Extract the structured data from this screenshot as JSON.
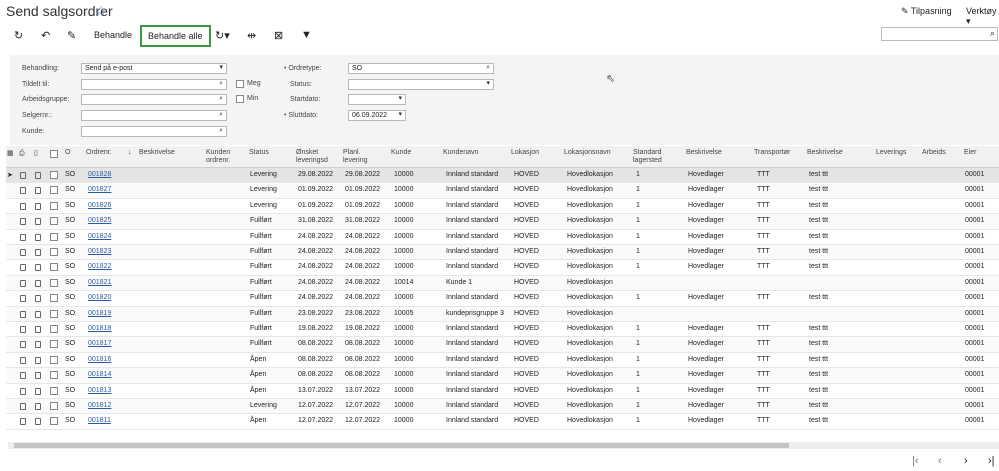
{
  "header": {
    "title": "Send salgsordrer",
    "customize": "Tilpasning",
    "tools": "Verktøy"
  },
  "toolbar": {
    "process": "Behandle",
    "process_all": "Behandle alle",
    "search_placeholder": ""
  },
  "filters": {
    "action_label": "Behandling:",
    "action_value": "Send på e-post",
    "assigned_label": "Tildelt til:",
    "assigned_value": "",
    "workgroup_label": "Arbeidsgruppe:",
    "workgroup_value": "",
    "salesperson_label": "Selgernr.:",
    "salesperson_value": "",
    "customer_label": "Kunde:",
    "customer_value": "",
    "me_label": "Meg",
    "my_label": "Min",
    "ordertype_label": "Ordretype:",
    "ordertype_value": "SO",
    "status_label": "Status:",
    "status_value": "",
    "startdate_label": "Startdato:",
    "startdate_value": "",
    "enddate_label": "Sluttdato:",
    "enddate_value": "06.09.2022"
  },
  "grid": {
    "headers": {
      "o": "O",
      "ordernr": "Ordrenr.",
      "sort": "↓",
      "desc": "Beskrivelse",
      "custorder": "Kunden ordrenr.",
      "status": "Status",
      "desired": "Ønsket leveringsd",
      "planned": "Planl. levering",
      "customer": "Kunde",
      "custname": "Kundenavn",
      "location": "Lokasjon",
      "locname": "Lokasjonsnavn",
      "stdwh": "Standard lagersted",
      "whdesc": "Beskrivelse",
      "carrier": "Transportør",
      "carrierdesc": "Beskrivelse",
      "delivery": "Leverings",
      "work": "Arbeids",
      "owner": "Eier"
    },
    "rows": [
      {
        "o": "SO",
        "nr": "001828",
        "status": "Levering",
        "desired": "29.08.2022",
        "planned": "29.08.2022",
        "cust": "10000",
        "custname": "Innland standard",
        "loc": "HOVED",
        "locname": "Hovedlokasjon",
        "wh": "1",
        "whdesc": "Hovedlager",
        "car": "TTT",
        "cardesc": "test ttt",
        "owner": "00001"
      },
      {
        "o": "SO",
        "nr": "001827",
        "status": "Levering",
        "desired": "01.09.2022",
        "planned": "01.09.2022",
        "cust": "10000",
        "custname": "Innland standard",
        "loc": "HOVED",
        "locname": "Hovedlokasjon",
        "wh": "1",
        "whdesc": "Hovedlager",
        "car": "TTT",
        "cardesc": "test ttt",
        "owner": "00001"
      },
      {
        "o": "SO",
        "nr": "001826",
        "status": "Levering",
        "desired": "01.09.2022",
        "planned": "01.09.2022",
        "cust": "10000",
        "custname": "Innland standard",
        "loc": "HOVED",
        "locname": "Hovedlokasjon",
        "wh": "1",
        "whdesc": "Hovedlager",
        "car": "TTT",
        "cardesc": "test ttt",
        "owner": "00001"
      },
      {
        "o": "SO",
        "nr": "001825",
        "status": "Fullført",
        "desired": "31.08.2022",
        "planned": "31.08.2022",
        "cust": "10000",
        "custname": "Innland standard",
        "loc": "HOVED",
        "locname": "Hovedlokasjon",
        "wh": "1",
        "whdesc": "Hovedlager",
        "car": "TTT",
        "cardesc": "test ttt",
        "owner": "00001"
      },
      {
        "o": "SO",
        "nr": "001824",
        "status": "Fullført",
        "desired": "24.08.2022",
        "planned": "24.08.2022",
        "cust": "10000",
        "custname": "Innland standard",
        "loc": "HOVED",
        "locname": "Hovedlokasjon",
        "wh": "1",
        "whdesc": "Hovedlager",
        "car": "TTT",
        "cardesc": "test ttt",
        "owner": "00001"
      },
      {
        "o": "SO",
        "nr": "001823",
        "status": "Fullført",
        "desired": "24.08.2022",
        "planned": "24.08.2022",
        "cust": "10000",
        "custname": "Innland standard",
        "loc": "HOVED",
        "locname": "Hovedlokasjon",
        "wh": "1",
        "whdesc": "Hovedlager",
        "car": "TTT",
        "cardesc": "test ttt",
        "owner": "00001"
      },
      {
        "o": "SO",
        "nr": "001822",
        "status": "Fullført",
        "desired": "24.08.2022",
        "planned": "24.08.2022",
        "cust": "10000",
        "custname": "Innland standard",
        "loc": "HOVED",
        "locname": "Hovedlokasjon",
        "wh": "1",
        "whdesc": "Hovedlager",
        "car": "TTT",
        "cardesc": "test ttt",
        "owner": "00001"
      },
      {
        "o": "SO",
        "nr": "001821",
        "status": "Fullført",
        "desired": "24.08.2022",
        "planned": "24.08.2022",
        "cust": "10014",
        "custname": "Kunde 1",
        "loc": "HOVED",
        "locname": "Hovedlokasjon",
        "wh": "",
        "whdesc": "",
        "car": "",
        "cardesc": "",
        "owner": "00001"
      },
      {
        "o": "SO",
        "nr": "001820",
        "status": "Fullført",
        "desired": "24.08.2022",
        "planned": "24.08.2022",
        "cust": "10000",
        "custname": "Innland standard",
        "loc": "HOVED",
        "locname": "Hovedlokasjon",
        "wh": "1",
        "whdesc": "Hovedlager",
        "car": "TTT",
        "cardesc": "test ttt",
        "owner": "00001"
      },
      {
        "o": "SO",
        "nr": "001819",
        "status": "Fullført",
        "desired": "23.08.2022",
        "planned": "23.08.2022",
        "cust": "10005",
        "custname": "kundeprisgruppe 3",
        "loc": "HOVED",
        "locname": "Hovedlokasjon",
        "wh": "",
        "whdesc": "",
        "car": "",
        "cardesc": "",
        "owner": "00001"
      },
      {
        "o": "SO",
        "nr": "001818",
        "status": "Fullført",
        "desired": "19.08.2022",
        "planned": "19.08.2022",
        "cust": "10000",
        "custname": "Innland standard",
        "loc": "HOVED",
        "locname": "Hovedlokasjon",
        "wh": "1",
        "whdesc": "Hovedlager",
        "car": "TTT",
        "cardesc": "test ttt",
        "owner": "00001"
      },
      {
        "o": "SO",
        "nr": "001817",
        "status": "Fullført",
        "desired": "08.08.2022",
        "planned": "08.08.2022",
        "cust": "10000",
        "custname": "Innland standard",
        "loc": "HOVED",
        "locname": "Hovedlokasjon",
        "wh": "1",
        "whdesc": "Hovedlager",
        "car": "TTT",
        "cardesc": "test ttt",
        "owner": "00001"
      },
      {
        "o": "SO",
        "nr": "001816",
        "status": "Åpen",
        "desired": "08.08.2022",
        "planned": "08.08.2022",
        "cust": "10000",
        "custname": "Innland standard",
        "loc": "HOVED",
        "locname": "Hovedlokasjon",
        "wh": "1",
        "whdesc": "Hovedlager",
        "car": "TTT",
        "cardesc": "test ttt",
        "owner": "00001"
      },
      {
        "o": "SO",
        "nr": "001814",
        "status": "Åpen",
        "desired": "08.08.2022",
        "planned": "08.08.2022",
        "cust": "10000",
        "custname": "Innland standard",
        "loc": "HOVED",
        "locname": "Hovedlokasjon",
        "wh": "1",
        "whdesc": "Hovedlager",
        "car": "TTT",
        "cardesc": "test ttt",
        "owner": "00001"
      },
      {
        "o": "SO",
        "nr": "001813",
        "status": "Åpen",
        "desired": "13.07.2022",
        "planned": "13.07.2022",
        "cust": "10000",
        "custname": "Innland standard",
        "loc": "HOVED",
        "locname": "Hovedlokasjon",
        "wh": "1",
        "whdesc": "Hovedlager",
        "car": "TTT",
        "cardesc": "test ttt",
        "owner": "00001"
      },
      {
        "o": "SO",
        "nr": "001812",
        "status": "Levering",
        "desired": "12.07.2022",
        "planned": "12.07.2022",
        "cust": "10000",
        "custname": "Innland standard",
        "loc": "HOVED",
        "locname": "Hovedlokasjon",
        "wh": "1",
        "whdesc": "Hovedlager",
        "car": "TTT",
        "cardesc": "test ttt",
        "owner": "00001"
      },
      {
        "o": "SO",
        "nr": "001811",
        "status": "Åpen",
        "desired": "12.07.2022",
        "planned": "12.07.2022",
        "cust": "10000",
        "custname": "Innland standard",
        "loc": "HOVED",
        "locname": "Hovedlokasjon",
        "wh": "1",
        "whdesc": "Hovedlager",
        "car": "TTT",
        "cardesc": "test ttt",
        "owner": "00001"
      }
    ]
  },
  "colors": {
    "highlight_border": "#3a9a3a",
    "link": "#2b5aa6",
    "selected_row": "#e4e4e4"
  }
}
